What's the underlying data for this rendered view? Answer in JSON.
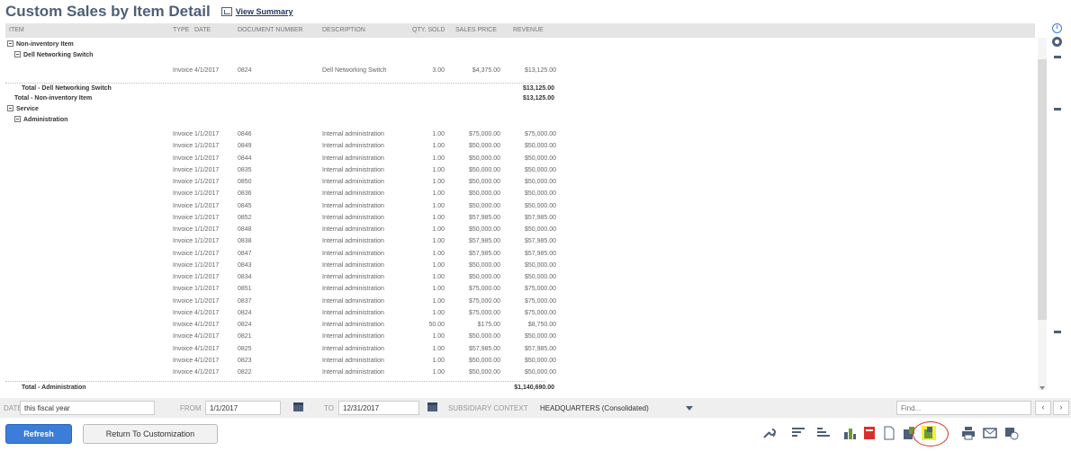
{
  "page": {
    "title": "Custom Sales by Item Detail",
    "view_summary": "View Summary"
  },
  "columns": {
    "item": "ITEM",
    "type": "TYPE",
    "date": "DATE",
    "document_number": "DOCUMENT NUMBER",
    "description": "DESCRIPTION",
    "qty_sold": "QTY. SOLD",
    "sales_price": "SALES PRICE",
    "revenue": "REVENUE"
  },
  "groups": {
    "non_inventory": "Non-inventory Item",
    "dell": "Dell Networking Switch",
    "total_dell": "Total - Dell Networking Switch",
    "total_dell_revenue": "$13,125.00",
    "total_non_inventory": "Total - Non-inventory Item",
    "total_non_inventory_revenue": "$13,125.00",
    "service": "Service",
    "administration": "Administration",
    "total_administration": "Total - Administration",
    "total_administration_revenue": "$1,140,690.00"
  },
  "dell_rows": [
    {
      "type": "Invoice",
      "date": "4/1/2017",
      "doc": "0824",
      "desc": "Dell Networking Switch",
      "qty": "3.00",
      "price": "$4,375.00",
      "revenue": "$13,125.00"
    }
  ],
  "admin_rows": [
    {
      "type": "Invoice",
      "date": "1/1/2017",
      "doc": "0846",
      "desc": "Internal administration",
      "qty": "1.00",
      "price": "$75,000.00",
      "revenue": "$75,000.00"
    },
    {
      "type": "Invoice",
      "date": "1/1/2017",
      "doc": "0849",
      "desc": "Internal administration",
      "qty": "1.00",
      "price": "$50,000.00",
      "revenue": "$50,000.00"
    },
    {
      "type": "Invoice",
      "date": "1/1/2017",
      "doc": "0844",
      "desc": "Internal administration",
      "qty": "1.00",
      "price": "$50,000.00",
      "revenue": "$50,000.00"
    },
    {
      "type": "Invoice",
      "date": "1/1/2017",
      "doc": "0835",
      "desc": "Internal administration",
      "qty": "1.00",
      "price": "$50,000.00",
      "revenue": "$50,000.00"
    },
    {
      "type": "Invoice",
      "date": "1/1/2017",
      "doc": "0850",
      "desc": "Internal administration",
      "qty": "1.00",
      "price": "$50,000.00",
      "revenue": "$50,000.00"
    },
    {
      "type": "Invoice",
      "date": "1/1/2017",
      "doc": "0836",
      "desc": "Internal administration",
      "qty": "1.00",
      "price": "$50,000.00",
      "revenue": "$50,000.00"
    },
    {
      "type": "Invoice",
      "date": "1/1/2017",
      "doc": "0845",
      "desc": "Internal administration",
      "qty": "1.00",
      "price": "$50,000.00",
      "revenue": "$50,000.00"
    },
    {
      "type": "Invoice",
      "date": "1/1/2017",
      "doc": "0852",
      "desc": "Internal administration",
      "qty": "1.00",
      "price": "$57,985.00",
      "revenue": "$57,985.00"
    },
    {
      "type": "Invoice",
      "date": "1/1/2017",
      "doc": "0848",
      "desc": "Internal administration",
      "qty": "1.00",
      "price": "$50,000.00",
      "revenue": "$50,000.00"
    },
    {
      "type": "Invoice",
      "date": "1/1/2017",
      "doc": "0838",
      "desc": "Internal administration",
      "qty": "1.00",
      "price": "$57,985.00",
      "revenue": "$57,985.00"
    },
    {
      "type": "Invoice",
      "date": "1/1/2017",
      "doc": "0847",
      "desc": "Internal administration",
      "qty": "1.00",
      "price": "$57,985.00",
      "revenue": "$57,985.00"
    },
    {
      "type": "Invoice",
      "date": "1/1/2017",
      "doc": "0843",
      "desc": "Internal administration",
      "qty": "1.00",
      "price": "$50,000.00",
      "revenue": "$50,000.00"
    },
    {
      "type": "Invoice",
      "date": "1/1/2017",
      "doc": "0834",
      "desc": "Internal administration",
      "qty": "1.00",
      "price": "$50,000.00",
      "revenue": "$50,000.00"
    },
    {
      "type": "Invoice",
      "date": "1/1/2017",
      "doc": "0851",
      "desc": "Internal administration",
      "qty": "1.00",
      "price": "$75,000.00",
      "revenue": "$75,000.00"
    },
    {
      "type": "Invoice",
      "date": "1/1/2017",
      "doc": "0837",
      "desc": "Internal administration",
      "qty": "1.00",
      "price": "$75,000.00",
      "revenue": "$75,000.00"
    },
    {
      "type": "Invoice",
      "date": "4/1/2017",
      "doc": "0824",
      "desc": "Internal administration",
      "qty": "1.00",
      "price": "$75,000.00",
      "revenue": "$75,000.00"
    },
    {
      "type": "Invoice",
      "date": "4/1/2017",
      "doc": "0824",
      "desc": "Internal administration",
      "qty": "50.00",
      "price": "$175.00",
      "revenue": "$8,750.00"
    },
    {
      "type": "Invoice",
      "date": "4/1/2017",
      "doc": "0821",
      "desc": "Internal administration",
      "qty": "1.00",
      "price": "$50,000.00",
      "revenue": "$50,000.00"
    },
    {
      "type": "Invoice",
      "date": "4/1/2017",
      "doc": "0825",
      "desc": "Internal administration",
      "qty": "1.00",
      "price": "$57,985.00",
      "revenue": "$57,985.00"
    },
    {
      "type": "Invoice",
      "date": "4/1/2017",
      "doc": "0823",
      "desc": "Internal administration",
      "qty": "1.00",
      "price": "$50,000.00",
      "revenue": "$50,000.00"
    },
    {
      "type": "Invoice",
      "date": "4/1/2017",
      "doc": "0822",
      "desc": "Internal administration",
      "qty": "1.00",
      "price": "$50,000.00",
      "revenue": "$50,000.00"
    }
  ],
  "filters": {
    "date_label": "DATE",
    "date_value": "this fiscal year",
    "from_label": "FROM",
    "from_value": "1/1/2017",
    "to_label": "TO",
    "to_value": "12/31/2017",
    "subsidiary_label": "SUBSIDIARY CONTEXT",
    "subsidiary_value": "HEADQUARTERS (Consolidated)",
    "find_placeholder": "Find..."
  },
  "buttons": {
    "refresh": "Refresh",
    "return": "Return To Customization"
  },
  "colors": {
    "primary": "#3b7dd8",
    "title": "#4d5f79",
    "highlight_ring": "#d9302b",
    "excel_highlight": "#f5ef3a"
  }
}
